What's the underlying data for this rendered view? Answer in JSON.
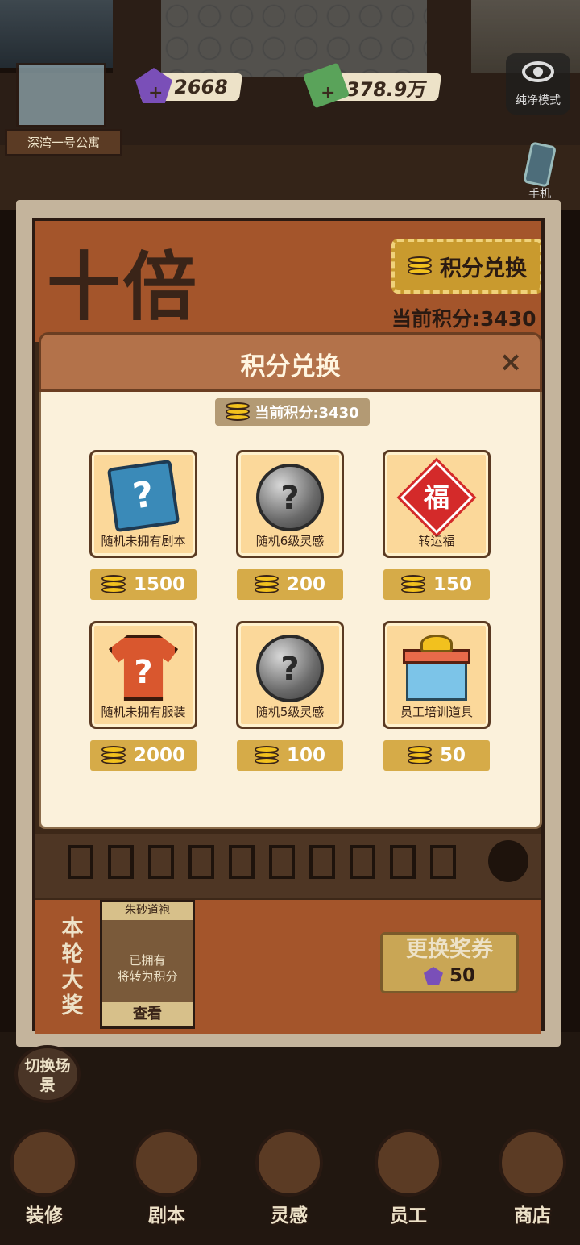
{
  "top_bar": {
    "gems": "2668",
    "cash": "378.9万",
    "pure_mode_label": "纯净模式",
    "phone_label": "手机",
    "apartment_label": "深湾一号公寓"
  },
  "event": {
    "title": "十倍",
    "exchange_tab_label": "积分兑换",
    "current_points_label": "当前积分:3430",
    "grand_prize_label": "本轮大奖",
    "prize_card": {
      "name": "朱砂道袍",
      "status": "已拥有",
      "convert_note": "将转为积分",
      "view_label": "查看"
    },
    "change_ticket_label": "更换奖券",
    "change_ticket_cost": "50"
  },
  "modal": {
    "title": "积分兑换",
    "close_label": "×",
    "current_points": "当前积分:3430",
    "items": [
      {
        "name": "随机未拥有剧本",
        "cost": "1500",
        "icon": "book-question-icon"
      },
      {
        "name": "随机6级灵感",
        "cost": "200",
        "icon": "gray-orb-question-icon"
      },
      {
        "name": "转运福",
        "cost": "150",
        "icon": "fu-charm-icon",
        "icon_glyph": "福"
      },
      {
        "name": "随机未拥有服装",
        "cost": "2000",
        "icon": "shirt-question-icon"
      },
      {
        "name": "随机5级灵感",
        "cost": "100",
        "icon": "gray-orb-question-icon"
      },
      {
        "name": "员工培训道具",
        "cost": "50",
        "icon": "gift-box-icon"
      }
    ],
    "question_mark": "?"
  },
  "bottom_nav": {
    "switch_scene_label": "切换场景",
    "items": [
      {
        "label": "装修",
        "icon": "house-icon"
      },
      {
        "label": "剧本",
        "icon": "script-book-icon"
      },
      {
        "label": "灵感",
        "icon": "lightbulb-icon"
      },
      {
        "label": "员工",
        "icon": "staff-card-icon"
      },
      {
        "label": "商店",
        "icon": "shop-icon"
      }
    ]
  },
  "colors": {
    "modal_header": "#b3724a",
    "modal_body": "#fbf1db",
    "item_card": "#fbd89a",
    "price_tag": "#d6ab48",
    "event_orange": "#a4552b"
  }
}
